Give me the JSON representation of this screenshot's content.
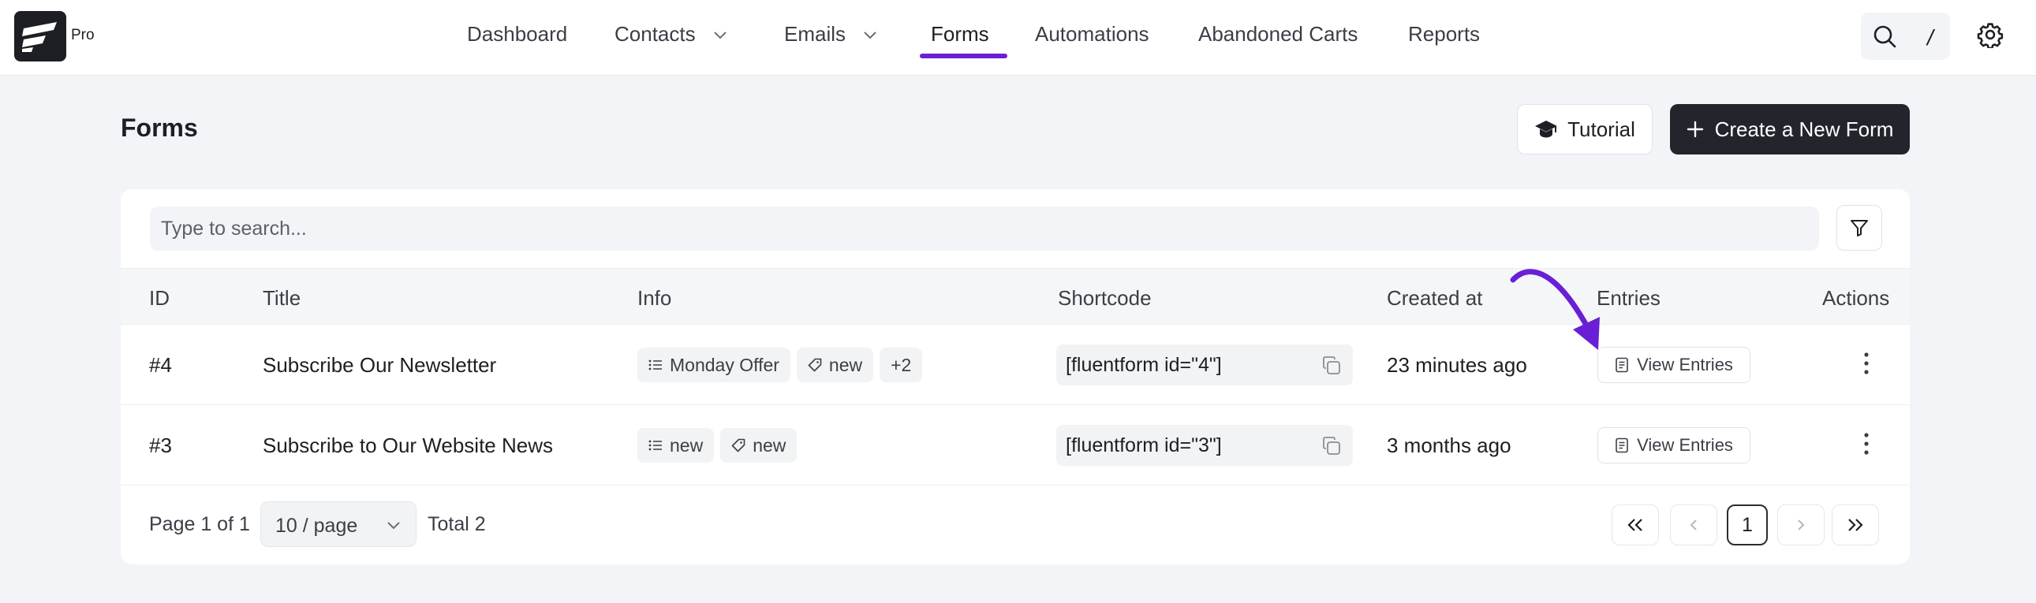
{
  "brand": {
    "badge": "Pro"
  },
  "nav": {
    "items": [
      {
        "label": "Dashboard",
        "has_dropdown": false,
        "active": false
      },
      {
        "label": "Contacts",
        "has_dropdown": true,
        "active": false
      },
      {
        "label": "Emails",
        "has_dropdown": true,
        "active": false
      },
      {
        "label": "Forms",
        "has_dropdown": false,
        "active": true
      },
      {
        "label": "Automations",
        "has_dropdown": false,
        "active": false
      },
      {
        "label": "Abandoned Carts",
        "has_dropdown": false,
        "active": false
      },
      {
        "label": "Reports",
        "has_dropdown": false,
        "active": false
      }
    ],
    "search_shortcut": "/",
    "accent_color": "#6a1fd6"
  },
  "page": {
    "title": "Forms",
    "tutorial_label": "Tutorial",
    "create_label": "Create a New Form"
  },
  "table": {
    "search_placeholder": "Type to search...",
    "columns": [
      "ID",
      "Title",
      "Info",
      "Shortcode",
      "Created at",
      "Entries",
      "Actions"
    ],
    "rows": [
      {
        "id": "#4",
        "title": "Subscribe Our Newsletter",
        "tags": [
          {
            "icon": "list-icon",
            "label": "Monday Offer"
          },
          {
            "icon": "tag-icon",
            "label": "new"
          },
          {
            "icon": "",
            "label": "+2"
          }
        ],
        "shortcode": "[fluentform id=\"4\"]",
        "created": "23 minutes ago",
        "entries_label": "View Entries"
      },
      {
        "id": "#3",
        "title": "Subscribe to Our Website News",
        "tags": [
          {
            "icon": "list-icon",
            "label": "new"
          },
          {
            "icon": "tag-icon",
            "label": "new"
          }
        ],
        "shortcode": "[fluentform id=\"3\"]",
        "created": "3 months ago",
        "entries_label": "View Entries"
      }
    ]
  },
  "pagination": {
    "page_info": "Page 1 of 1",
    "page_size": "10 / page",
    "total": "Total 2",
    "current_page": "1"
  }
}
